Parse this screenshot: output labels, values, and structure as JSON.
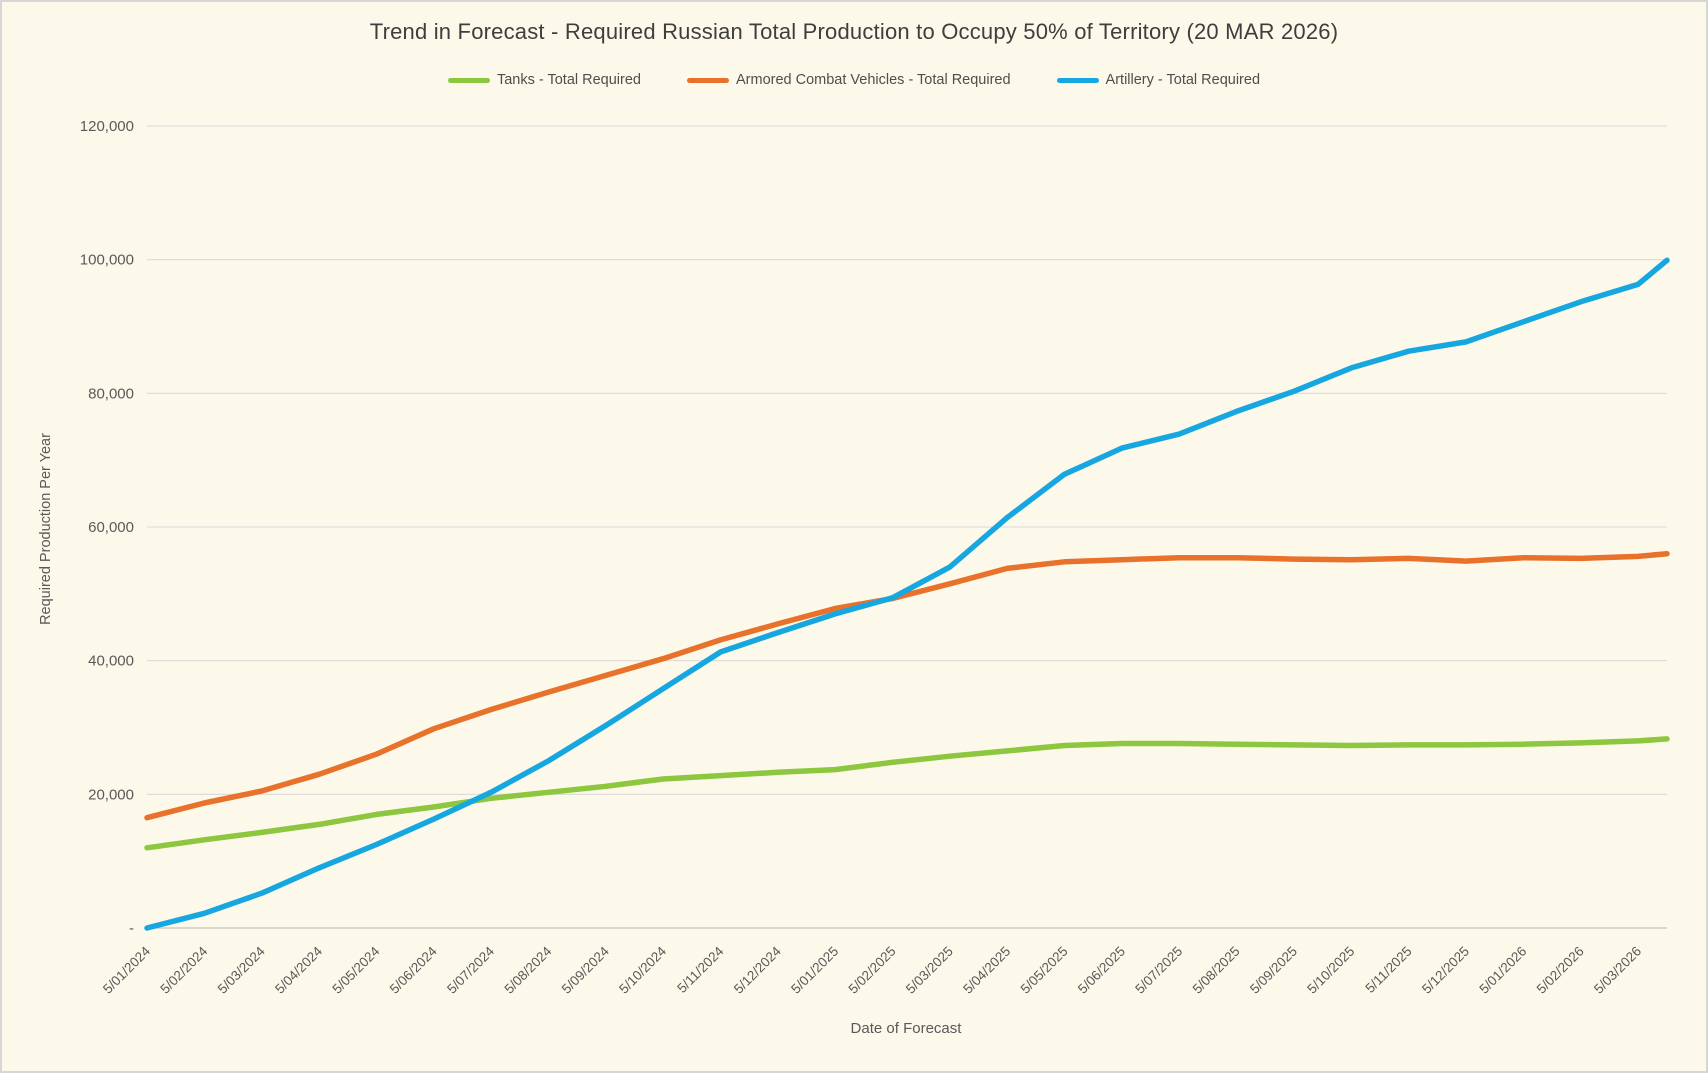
{
  "window": {
    "background_color": "#FDF9EA",
    "border_color": "#D6D6D6"
  },
  "chart_data": {
    "type": "line",
    "title": "Trend in Forecast - Required Russian Total Production to Occupy 50% of Territory (20 MAR 2026)",
    "xlabel": "Date of Forecast",
    "ylabel": "Required Production Per Year",
    "ylim": [
      0,
      120000
    ],
    "ytick_interval": 20000,
    "ytick_labels": [
      "-",
      "20,000",
      "40,000",
      "60,000",
      "80,000",
      "100,000",
      "120,000"
    ],
    "zero_tick_label": "-",
    "grid": true,
    "legend_position": "top-center",
    "gridline_color": "#D9D9D9",
    "axisline_color": "#CFCCC3",
    "text_color": "#595959",
    "categories": [
      "5/01/2024",
      "5/02/2024",
      "5/03/2024",
      "5/04/2024",
      "5/05/2024",
      "5/06/2024",
      "5/07/2024",
      "5/08/2024",
      "5/09/2024",
      "5/10/2024",
      "5/11/2024",
      "5/12/2024",
      "5/01/2025",
      "5/02/2025",
      "5/03/2025",
      "5/04/2025",
      "5/05/2025",
      "5/06/2025",
      "5/07/2025",
      "5/08/2025",
      "5/09/2025",
      "5/10/2025",
      "5/11/2025",
      "5/12/2025",
      "5/01/2026",
      "5/02/2026",
      "5/03/2026"
    ],
    "series": [
      {
        "name": "Tanks - Total Required",
        "color": "#8DC63F",
        "values": [
          12000,
          13200,
          14300,
          15500,
          17000,
          18100,
          19400,
          20300,
          21200,
          22300,
          22800,
          23300,
          23700,
          24800,
          25700,
          26500,
          27300,
          27600,
          27600,
          27500,
          27400,
          27300,
          27400,
          27400,
          27500,
          27700,
          28000
        ],
        "final_value": 28300
      },
      {
        "name": "Armored Combat Vehicles - Total Required",
        "color": "#E8712B",
        "values": [
          16500,
          18700,
          20500,
          23000,
          26000,
          29800,
          32700,
          35300,
          37800,
          40300,
          43100,
          45500,
          47800,
          49300,
          51500,
          53800,
          54800,
          55100,
          55400,
          55400,
          55200,
          55100,
          55300,
          54900,
          55400,
          55300,
          55600
        ],
        "final_value": 56000
      },
      {
        "name": "Artillery - Total Required",
        "color": "#17A7E0",
        "values": [
          0,
          2200,
          5200,
          9000,
          12500,
          16300,
          20300,
          25000,
          30300,
          35800,
          41300,
          44200,
          47000,
          49400,
          54000,
          61400,
          67900,
          71800,
          73900,
          77300,
          80300,
          83800,
          86300,
          87700,
          90700,
          93700,
          96300
        ],
        "final_value": 99900
      }
    ]
  }
}
